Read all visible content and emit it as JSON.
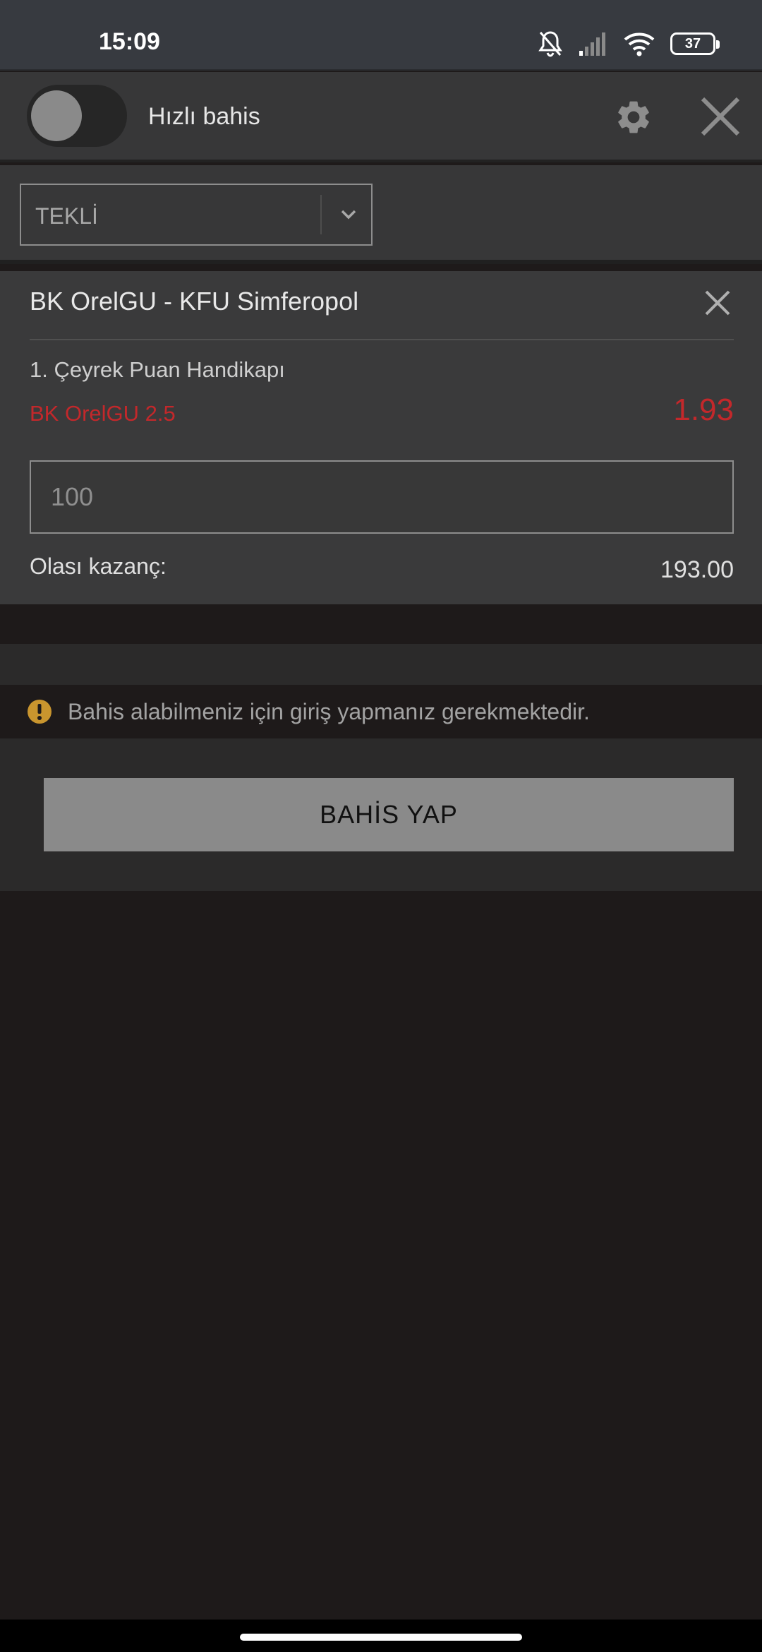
{
  "status_bar": {
    "time": "15:09",
    "battery": "37",
    "icons": [
      "bell-off-icon",
      "signal-icon",
      "wifi-icon",
      "battery-icon"
    ]
  },
  "header": {
    "quick_bet_label": "Hızlı bahis",
    "quick_bet_enabled": false,
    "icons": [
      "gear-icon",
      "close-icon"
    ]
  },
  "bet_type": {
    "selected": "TEKLİ"
  },
  "bet": {
    "match": "BK OrelGU - KFU Simferopol",
    "market": "1. Çeyrek Puan Handikapı",
    "selection": "BK OrelGU 2.5",
    "odds": "1.93",
    "stake_placeholder": "100",
    "potential_win_label": "Olası kazanç:",
    "potential_win_value": "193.00"
  },
  "notice": {
    "text": "Bahis alabilmeniz için giriş yapmanız gerekmektedir."
  },
  "actions": {
    "place_bet_label": "BAHİS YAP"
  },
  "colors": {
    "accent_red": "#c3282b",
    "warning": "#c9952e",
    "button_gray": "#8a8a8a",
    "panel": "#373738",
    "background": "#1e1a1a"
  }
}
